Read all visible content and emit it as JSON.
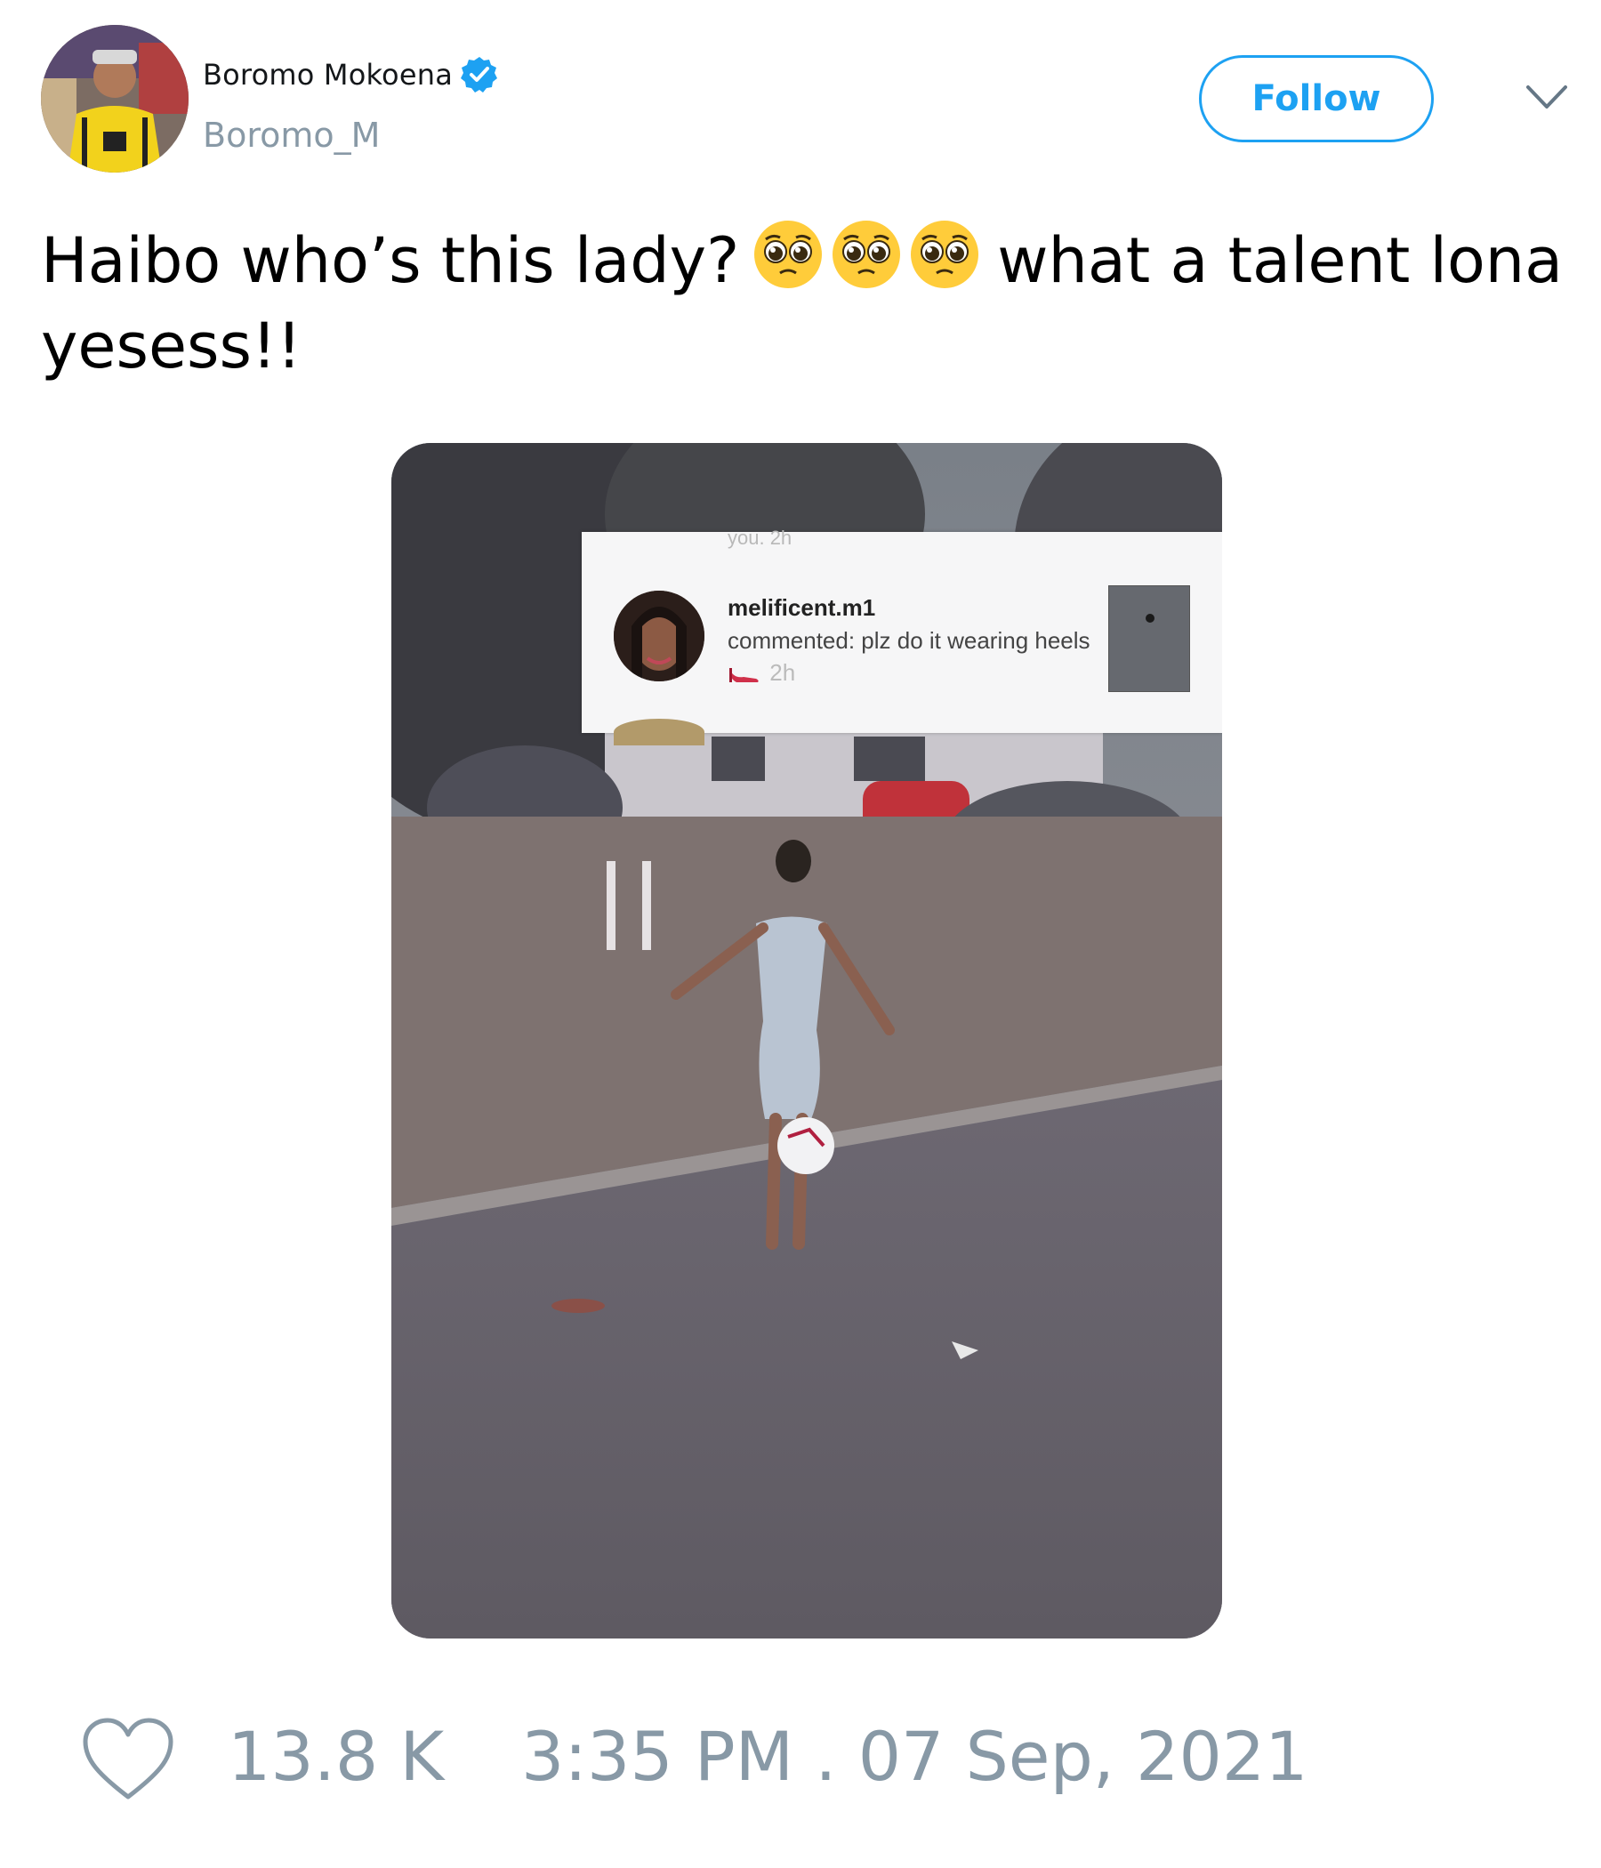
{
  "user": {
    "display_name": "Boromo Mokoena",
    "handle": "Boromo_M",
    "verified": true,
    "verified_icon": "verified-badge-icon"
  },
  "actions": {
    "follow_label": "Follow",
    "menu_icon": "chevron-down-icon"
  },
  "tweet": {
    "text_before_emoji": "Haibo who’s this lady?",
    "emoji": [
      "pleading-face",
      "pleading-face",
      "pleading-face"
    ],
    "text_after_emoji": "what a talent lona yesess!!"
  },
  "media": {
    "type": "video-screenshot",
    "overlay": {
      "peek_top_text": "you. 2h",
      "username": "melificent.m1",
      "comment_prefix": "commented: plz do it wearing heels",
      "comment_time": "2h",
      "emoji": "high-heel-icon"
    }
  },
  "footer": {
    "like_icon": "heart-icon",
    "like_count": "13.8 K",
    "timestamp": "3:35 PM . 07 Sep, 2021"
  },
  "colors": {
    "accent": "#1da1f2",
    "muted": "#8899a6",
    "text": "#000000"
  }
}
